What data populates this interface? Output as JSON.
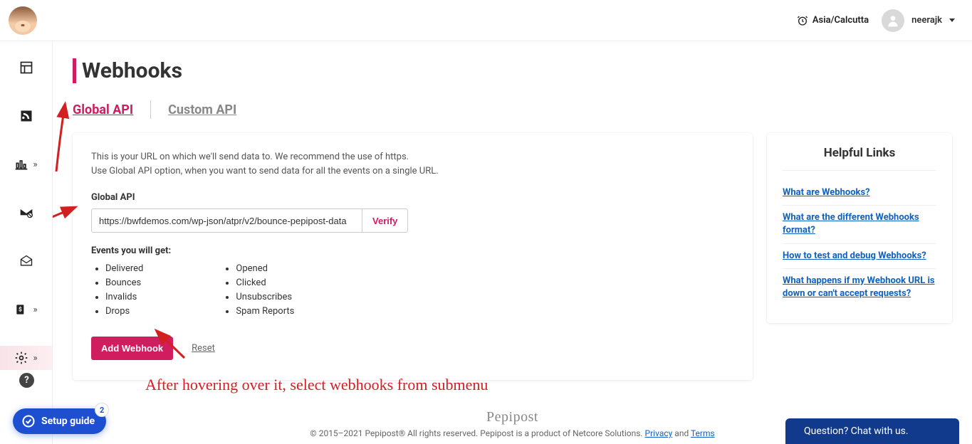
{
  "header": {
    "timezone": "Asia/Calcutta",
    "username": "neerajk"
  },
  "page": {
    "title": "Webhooks"
  },
  "tabs": {
    "global": "Global API",
    "custom": "Custom API"
  },
  "main": {
    "description_line1": "This is your URL on which we'll send data to. We recommend the use of https.",
    "description_line2": "Use Global API option, when you want to send data for all the events on a single URL.",
    "input_label": "Global API",
    "input_value": "https://bwfdemos.com/wp-json/atpr/v2/bounce-pepipost-data",
    "verify_label": "Verify",
    "events_title": "Events you will get:",
    "events_col1": [
      "Delivered",
      "Bounces",
      "Invalids",
      "Drops"
    ],
    "events_col2": [
      "Opened",
      "Clicked",
      "Unsubscribes",
      "Spam Reports"
    ],
    "add_webhook_label": "Add Webhook",
    "reset_label": "Reset"
  },
  "helpful": {
    "title": "Helpful Links",
    "links": [
      "What are Webhooks?",
      "What are the different Webhooks format?",
      "How to test and debug Webhooks?",
      "What happens if my Webhook URL is down or can't accept requests?"
    ]
  },
  "annotation": {
    "text": "After hovering over it, select webhooks from submenu"
  },
  "footer": {
    "brand": "Pepipost",
    "copyright": "© 2015–2021 Pepipost® All rights reserved. Pepipost is a product of Netcore Solutions. ",
    "privacy": "Privacy",
    "and": " and ",
    "terms": "Terms"
  },
  "setup_guide": {
    "label": "Setup guide",
    "badge": "2"
  },
  "chat": {
    "label": "Question? Chat with us."
  }
}
